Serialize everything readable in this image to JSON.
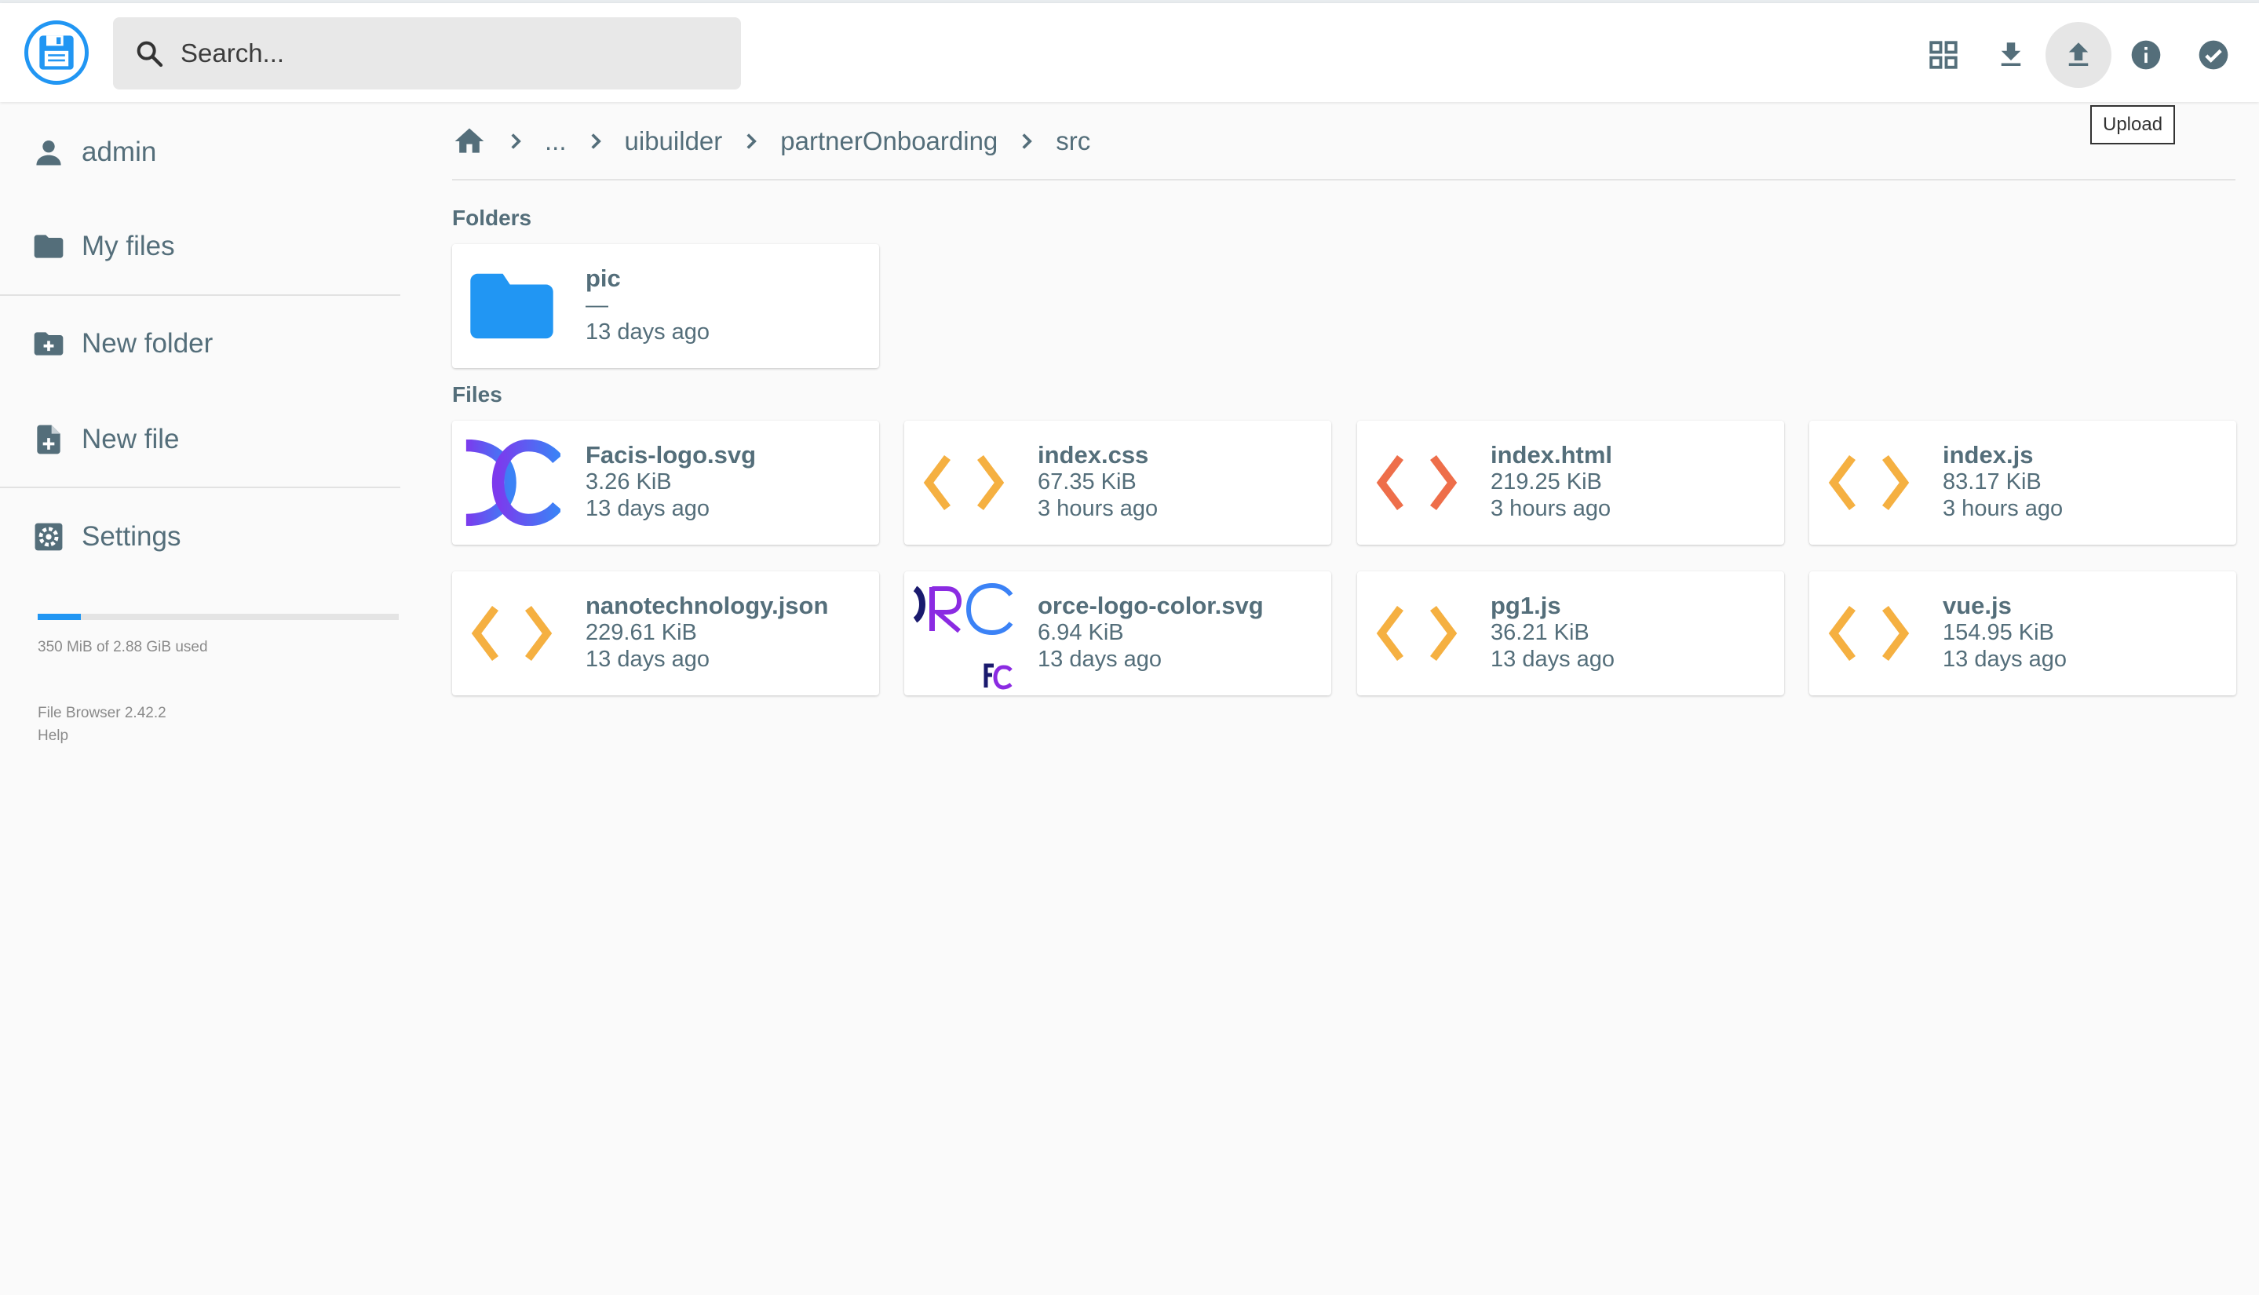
{
  "colors": {
    "accent": "#2196f3",
    "code_orange": "#f5b041",
    "code_red": "#ee6e4a",
    "text": "#546e7a"
  },
  "header": {
    "search": {
      "placeholder": "Search...",
      "value": ""
    },
    "actions": [
      {
        "name": "grid-view-icon",
        "label": "Switch view"
      },
      {
        "name": "download-icon",
        "label": "Download"
      },
      {
        "name": "upload-icon",
        "label": "Upload"
      },
      {
        "name": "info-icon",
        "label": "Info"
      },
      {
        "name": "check-circle-icon",
        "label": "Select multiple"
      }
    ],
    "tooltip": "Upload"
  },
  "sidebar": {
    "user": {
      "label": "admin",
      "icon": "person-icon"
    },
    "my_files": {
      "label": "My files",
      "icon": "folder-icon"
    },
    "new_folder": {
      "label": "New folder",
      "icon": "create-new-folder-icon"
    },
    "new_file": {
      "label": "New file",
      "icon": "note-add-icon"
    },
    "settings": {
      "label": "Settings",
      "icon": "settings-icon"
    },
    "usage": {
      "text": "350 MiB of 2.88 GiB used",
      "fraction": 0.12
    },
    "version": "File Browser 2.42.2",
    "help": "Help"
  },
  "breadcrumbs": [
    "...",
    "uibuilder",
    "partnerOnboarding",
    "src"
  ],
  "sections": {
    "folders": "Folders",
    "files": "Files"
  },
  "folders": [
    {
      "name": "pic",
      "size": "—",
      "modified": "13 days ago",
      "icon": "folder-icon"
    }
  ],
  "files": [
    {
      "name": "Facis-logo.svg",
      "size": "3.26 KiB",
      "modified": "13 days ago",
      "icon": "facis-logo-thumbnail"
    },
    {
      "name": "index.css",
      "size": "67.35 KiB",
      "modified": "3 hours ago",
      "icon": "code-icon"
    },
    {
      "name": "index.html",
      "size": "219.25 KiB",
      "modified": "3 hours ago",
      "icon": "code-icon"
    },
    {
      "name": "index.js",
      "size": "83.17 KiB",
      "modified": "3 hours ago",
      "icon": "code-icon"
    },
    {
      "name": "nanotechnology.json",
      "size": "229.61 KiB",
      "modified": "13 days ago",
      "icon": "code-icon"
    },
    {
      "name": "orce-logo-color.svg",
      "size": "6.94 KiB",
      "modified": "13 days ago",
      "icon": "orce-logo-thumbnail"
    },
    {
      "name": "pg1.js",
      "size": "36.21 KiB",
      "modified": "13 days ago",
      "icon": "code-icon"
    },
    {
      "name": "vue.js",
      "size": "154.95 KiB",
      "modified": "13 days ago",
      "icon": "code-icon"
    }
  ]
}
